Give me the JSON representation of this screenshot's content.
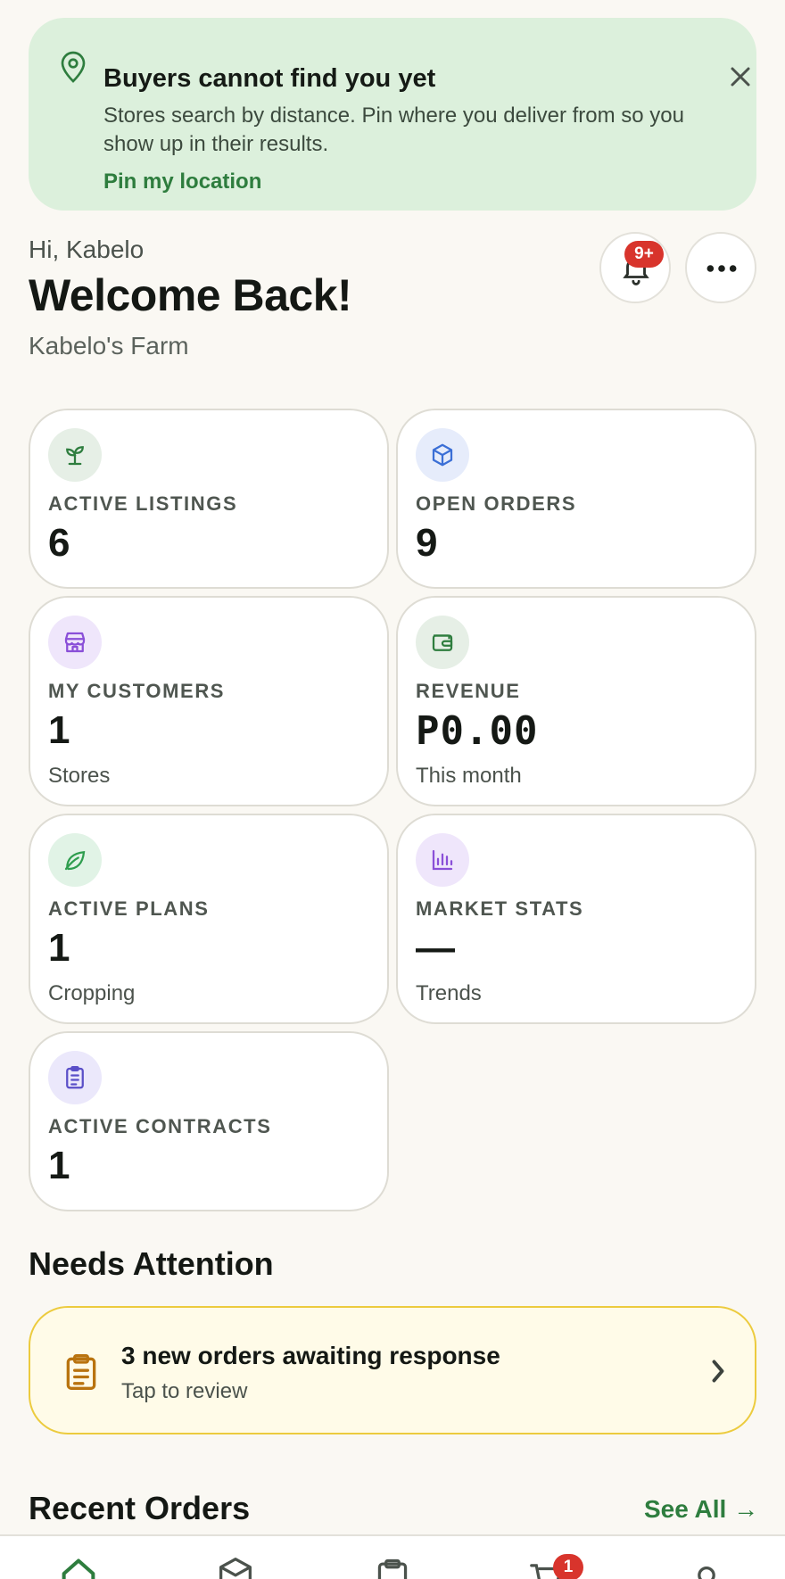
{
  "banner": {
    "title": "Buyers cannot find you yet",
    "body": "Stores search by distance. Pin where you deliver from so you show up in their results.",
    "cta": "Pin my location",
    "icon": "map-pin-icon",
    "close_icon": "close-icon"
  },
  "header": {
    "greeting": "Hi, Kabelo",
    "title": "Welcome Back!",
    "farm": "Kabelo's Farm",
    "notification_badge": "9+"
  },
  "stats": [
    {
      "label": "ACTIVE LISTINGS",
      "value": "6",
      "sub": "",
      "icon": "sprout-icon",
      "icon_color": "#2e7d3e",
      "icon_bg": "#e6efe6"
    },
    {
      "label": "OPEN ORDERS",
      "value": "9",
      "sub": "",
      "icon": "box-icon",
      "icon_color": "#3b6fd6",
      "icon_bg": "#e6ecfb"
    },
    {
      "label": "MY CUSTOMERS",
      "value": "1",
      "sub": "Stores",
      "icon": "store-icon",
      "icon_color": "#8a4fd8",
      "icon_bg": "#efe6fb"
    },
    {
      "label": "REVENUE",
      "value": "P0.00",
      "sub": "This month",
      "icon": "wallet-icon",
      "icon_color": "#2e7d3e",
      "icon_bg": "#e6efe6"
    },
    {
      "label": "ACTIVE PLANS",
      "value": "1",
      "sub": "Cropping",
      "icon": "leaf-icon",
      "icon_color": "#2e9d4e",
      "icon_bg": "#e1f3e6"
    },
    {
      "label": "MARKET STATS",
      "value": "—",
      "sub": "Trends",
      "icon": "bar-chart-icon",
      "icon_color": "#8a4fd8",
      "icon_bg": "#efe6fb"
    },
    {
      "label": "ACTIVE CONTRACTS",
      "value": "1",
      "sub": "",
      "icon": "clipboard-icon",
      "icon_color": "#5a4fc8",
      "icon_bg": "#ebe8fb"
    }
  ],
  "needs_attention": {
    "title": "Needs Attention",
    "item_title": "3 new orders awaiting response",
    "item_sub": "Tap to review",
    "icon": "clipboard-icon",
    "color": "#b9730f"
  },
  "recent_orders": {
    "title": "Recent Orders",
    "see_all": "See All →"
  },
  "bottom_nav": {
    "items": [
      "home-icon",
      "box-icon",
      "clipboard-icon",
      "cart-icon",
      "profile-icon"
    ],
    "cart_badge": "1",
    "accent": "#2e7d3e"
  }
}
